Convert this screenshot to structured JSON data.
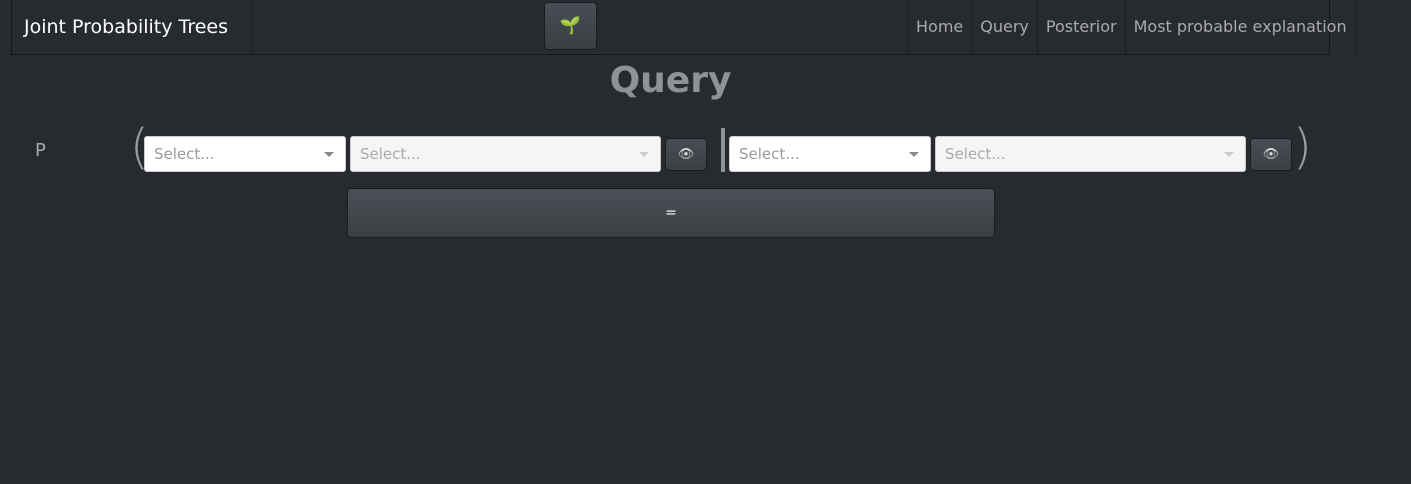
{
  "navbar": {
    "brand": "Joint Probability Trees",
    "logo_icon": "🌱",
    "links": [
      {
        "label": "Home"
      },
      {
        "label": "Query"
      },
      {
        "label": "Posterior"
      },
      {
        "label": "Most probable explanation"
      }
    ]
  },
  "page": {
    "title": "Query"
  },
  "query": {
    "p_label": "P",
    "left_paren": "(",
    "right_paren": ")",
    "selects": [
      {
        "placeholder": "Select..."
      },
      {
        "placeholder": "Select..."
      },
      {
        "placeholder": "Select..."
      },
      {
        "placeholder": "Select..."
      }
    ],
    "eye_icon": "👁",
    "equals_label": "="
  }
}
